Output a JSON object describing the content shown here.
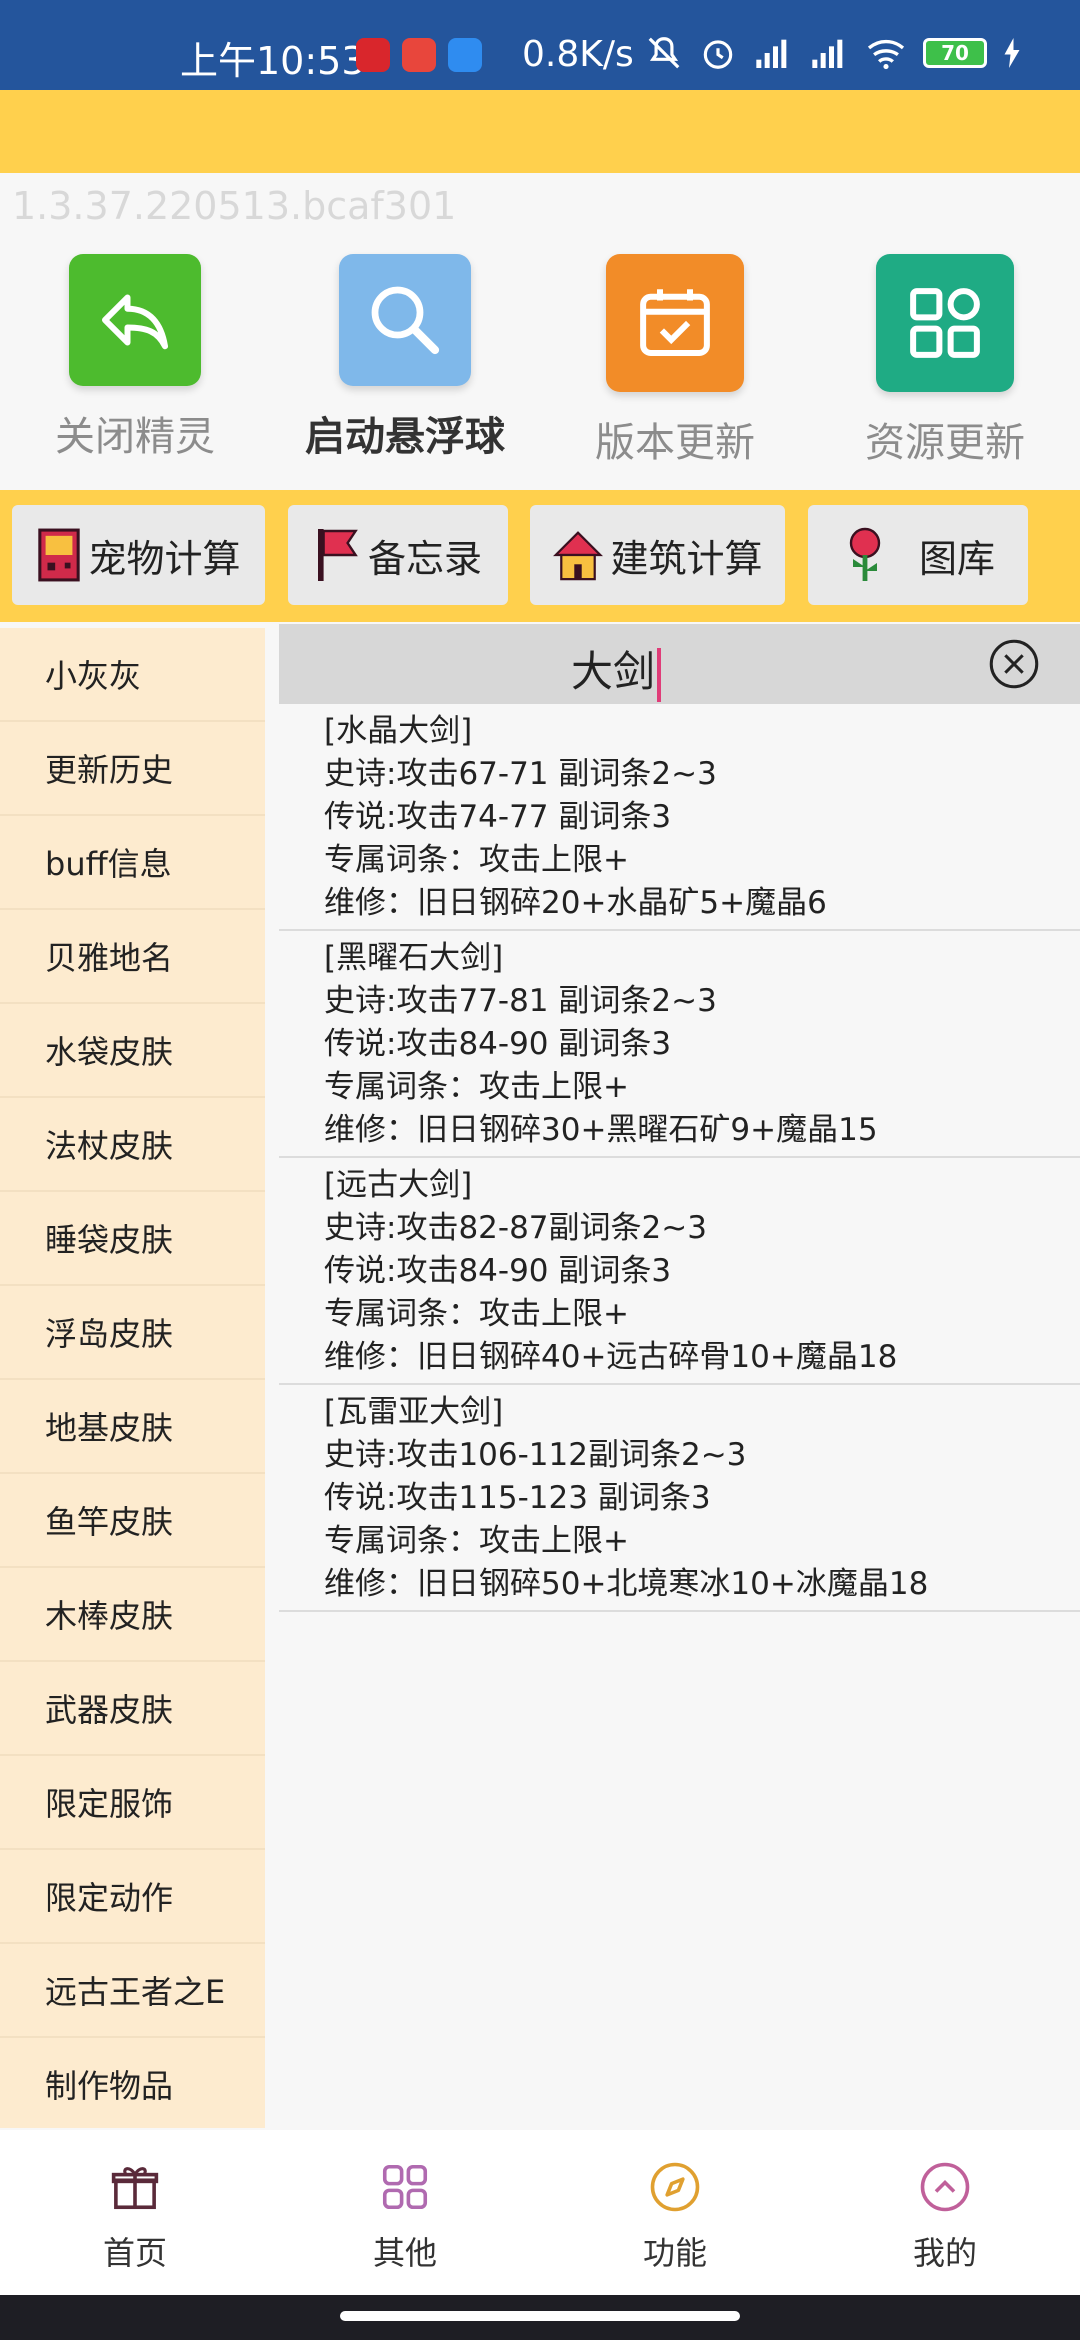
{
  "status_bar": {
    "time": "上午10:53",
    "speed": "0.8K/s",
    "battery": "70"
  },
  "version": "1.3.37.220513.bcaf301",
  "top_icons": [
    {
      "label": "关闭精灵",
      "icon": "reply-arrow-icon",
      "color": "#4dbb2e"
    },
    {
      "label": "启动悬浮球",
      "icon": "search-icon",
      "color": "#7fb8ea"
    },
    {
      "label": "版本更新",
      "icon": "calendar-check-icon",
      "color": "#f28c28"
    },
    {
      "label": "资源更新",
      "icon": "grid-icon",
      "color": "#1fab84"
    }
  ],
  "tools": [
    {
      "label": "宠物计算",
      "icon": "gameboy-icon"
    },
    {
      "label": "备忘录",
      "icon": "flag-icon"
    },
    {
      "label": "建筑计算",
      "icon": "house-icon"
    },
    {
      "label": "图库",
      "icon": "flower-icon"
    }
  ],
  "sidebar": {
    "items": [
      "小灰灰",
      "更新历史",
      "buff信息",
      "贝雅地名",
      "水袋皮肤",
      "法杖皮肤",
      "睡袋皮肤",
      "浮岛皮肤",
      "地基皮肤",
      "鱼竿皮肤",
      "木棒皮肤",
      "武器皮肤",
      "限定服饰",
      "限定动作",
      "远古王者之E",
      "制作物品"
    ]
  },
  "search": {
    "value": "大剑"
  },
  "results": [
    {
      "lines": [
        "[水晶大剑]",
        "史诗:攻击67-71 副词条2~3",
        "传说:攻击74-77 副词条3",
        "专属词条：攻击上限+",
        "维修：旧日钢碎20+水晶矿5+魔晶6"
      ]
    },
    {
      "lines": [
        "[黑曜石大剑]",
        "史诗:攻击77-81 副词条2~3",
        "传说:攻击84-90 副词条3",
        "专属词条：攻击上限+",
        "维修：旧日钢碎30+黑曜石矿9+魔晶15"
      ]
    },
    {
      "lines": [
        "[远古大剑]",
        "史诗:攻击82-87副词条2~3",
        "传说:攻击84-90 副词条3",
        "专属词条：攻击上限+",
        "维修：旧日钢碎40+远古碎骨10+魔晶18"
      ]
    },
    {
      "lines": [
        "[瓦雷亚大剑]",
        "史诗:攻击106-112副词条2~3",
        "传说:攻击115-123 副词条3",
        "专属词条：攻击上限+",
        "维修：旧日钢碎50+北境寒冰10+冰魔晶18"
      ]
    }
  ],
  "bottom_nav": [
    {
      "label": "首页",
      "icon": "gift-icon",
      "color": "#5a2a3a"
    },
    {
      "label": "其他",
      "icon": "grid-icon",
      "color": "#b06ab0"
    },
    {
      "label": "功能",
      "icon": "compass-icon",
      "color": "#e0a030"
    },
    {
      "label": "我的",
      "icon": "chevron-up-circle-icon",
      "color": "#c0609a"
    }
  ]
}
